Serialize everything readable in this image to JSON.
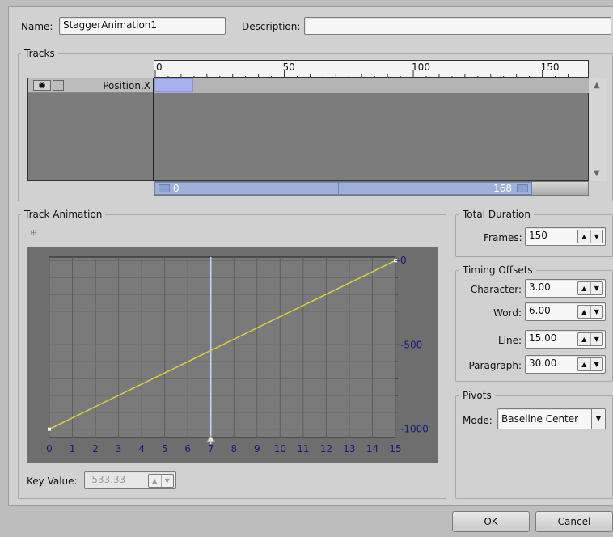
{
  "header": {
    "name_label": "Name:",
    "name_value": "StaggerAnimation1",
    "description_label": "Description:",
    "description_value": ""
  },
  "tracks": {
    "title": "Tracks",
    "ruler_ticks": [
      "0",
      "50",
      "100",
      "150"
    ],
    "rows": [
      {
        "label": "Position.X"
      }
    ],
    "range_start": "0",
    "range_end": "168"
  },
  "track_animation": {
    "title": "Track Animation",
    "key_value_label": "Key Value:",
    "key_value": "-533.33"
  },
  "chart_data": {
    "type": "line",
    "x": [
      0,
      15
    ],
    "y": [
      -1000,
      0
    ],
    "xlim": [
      0,
      15
    ],
    "ylim": [
      -1050,
      20
    ],
    "x_ticks": [
      "0",
      "1",
      "2",
      "3",
      "4",
      "5",
      "6",
      "7",
      "8",
      "9",
      "10",
      "11",
      "12",
      "13",
      "14",
      "15"
    ],
    "y_ticks": [
      0,
      -500,
      -1000
    ],
    "y_tick_labels": [
      "0",
      "-500",
      "-1000"
    ],
    "cursor_x": 7,
    "line_color": "#d8d040",
    "cursor_color": "#c9d3ff"
  },
  "total_duration": {
    "title": "Total Duration",
    "frames_label": "Frames:",
    "frames_value": "150"
  },
  "timing_offsets": {
    "title": "Timing Offsets",
    "items": [
      {
        "label": "Character:",
        "value": "3.00"
      },
      {
        "label": "Word:",
        "value": "6.00"
      },
      {
        "label": "Line:",
        "value": "15.00"
      },
      {
        "label": "Paragraph:",
        "value": "30.00"
      }
    ]
  },
  "pivots": {
    "title": "Pivots",
    "mode_label": "Mode:",
    "mode_value": "Baseline Center"
  },
  "buttons": {
    "ok": "OK",
    "cancel": "Cancel"
  }
}
